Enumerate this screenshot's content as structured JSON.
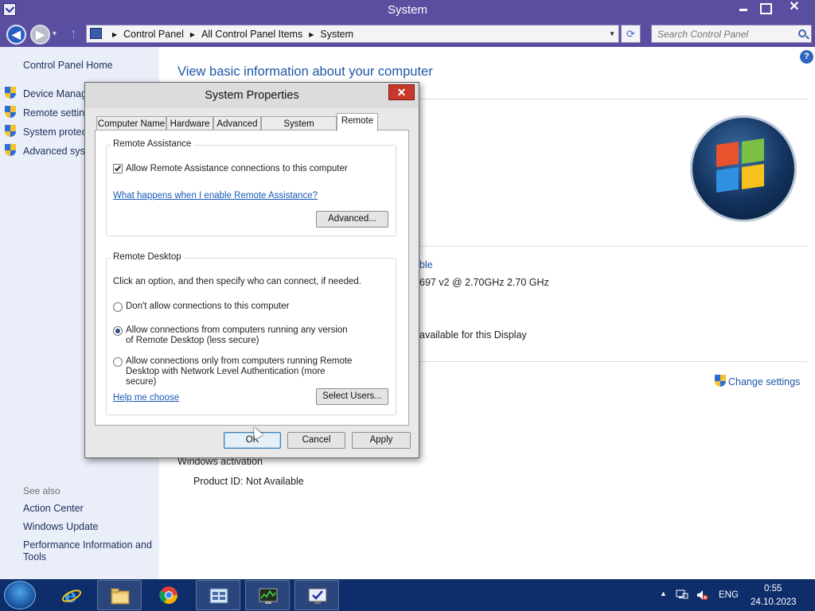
{
  "window": {
    "title": "System",
    "close_glyph": "✕"
  },
  "address_bar": {
    "crumbs": [
      "Control Panel",
      "All Control Panel Items",
      "System"
    ],
    "search_placeholder": "Search Control Panel"
  },
  "sidebar": {
    "home": "Control Panel Home",
    "links": [
      "Device Manager",
      "Remote settings",
      "System protection",
      "Advanced system settings"
    ],
    "see_also": "See also",
    "see_also_links": [
      "Action Center",
      "Windows Update",
      "Performance Information and Tools"
    ]
  },
  "content": {
    "title": "View basic information about your computer",
    "partial_rating": "ble",
    "processor_partial": "697 v2 @ 2.70GHz   2.70 GHz",
    "pen_touch_partial": "available for this Display",
    "change_settings": "Change settings",
    "activation_heading": "Windows activation",
    "product_id_label": "Product ID:",
    "product_id_value": "Not Available"
  },
  "dialog": {
    "title": "System Properties",
    "close_glyph": "✕",
    "tabs": [
      "Computer Name",
      "Hardware",
      "Advanced",
      "System Protection",
      "Remote"
    ],
    "active_tab": "Remote",
    "remote_assistance": {
      "label": "Remote Assistance",
      "checkbox_label": "Allow Remote Assistance connections to this computer",
      "checked": true,
      "link": "What happens when I enable Remote Assistance?",
      "advanced_button": "Advanced..."
    },
    "remote_desktop": {
      "label": "Remote Desktop",
      "instruction": "Click an option, and then specify who can connect, if needed.",
      "options": [
        "Don't allow connections to this computer",
        "Allow connections from computers running any version of Remote Desktop (less secure)",
        "Allow connections only from computers running Remote Desktop with Network Level Authentication (more secure)"
      ],
      "selected_option": 1,
      "help_link": "Help me choose",
      "select_users_button": "Select Users..."
    },
    "buttons": {
      "ok": "OK",
      "cancel": "Cancel",
      "apply": "Apply"
    }
  },
  "taskbar": {
    "pinned": [
      "internet-explorer",
      "file-explorer",
      "chrome",
      "control-panel",
      "task-manager",
      "system-properties"
    ],
    "language": "ENG",
    "time": "0:55",
    "date": "24.10.2023"
  },
  "colors": {
    "title_bar": "#5a4ea1",
    "link_blue": "#1d56a6",
    "taskbar": "#0d2d6b",
    "dialog_close": "#c7372b"
  }
}
